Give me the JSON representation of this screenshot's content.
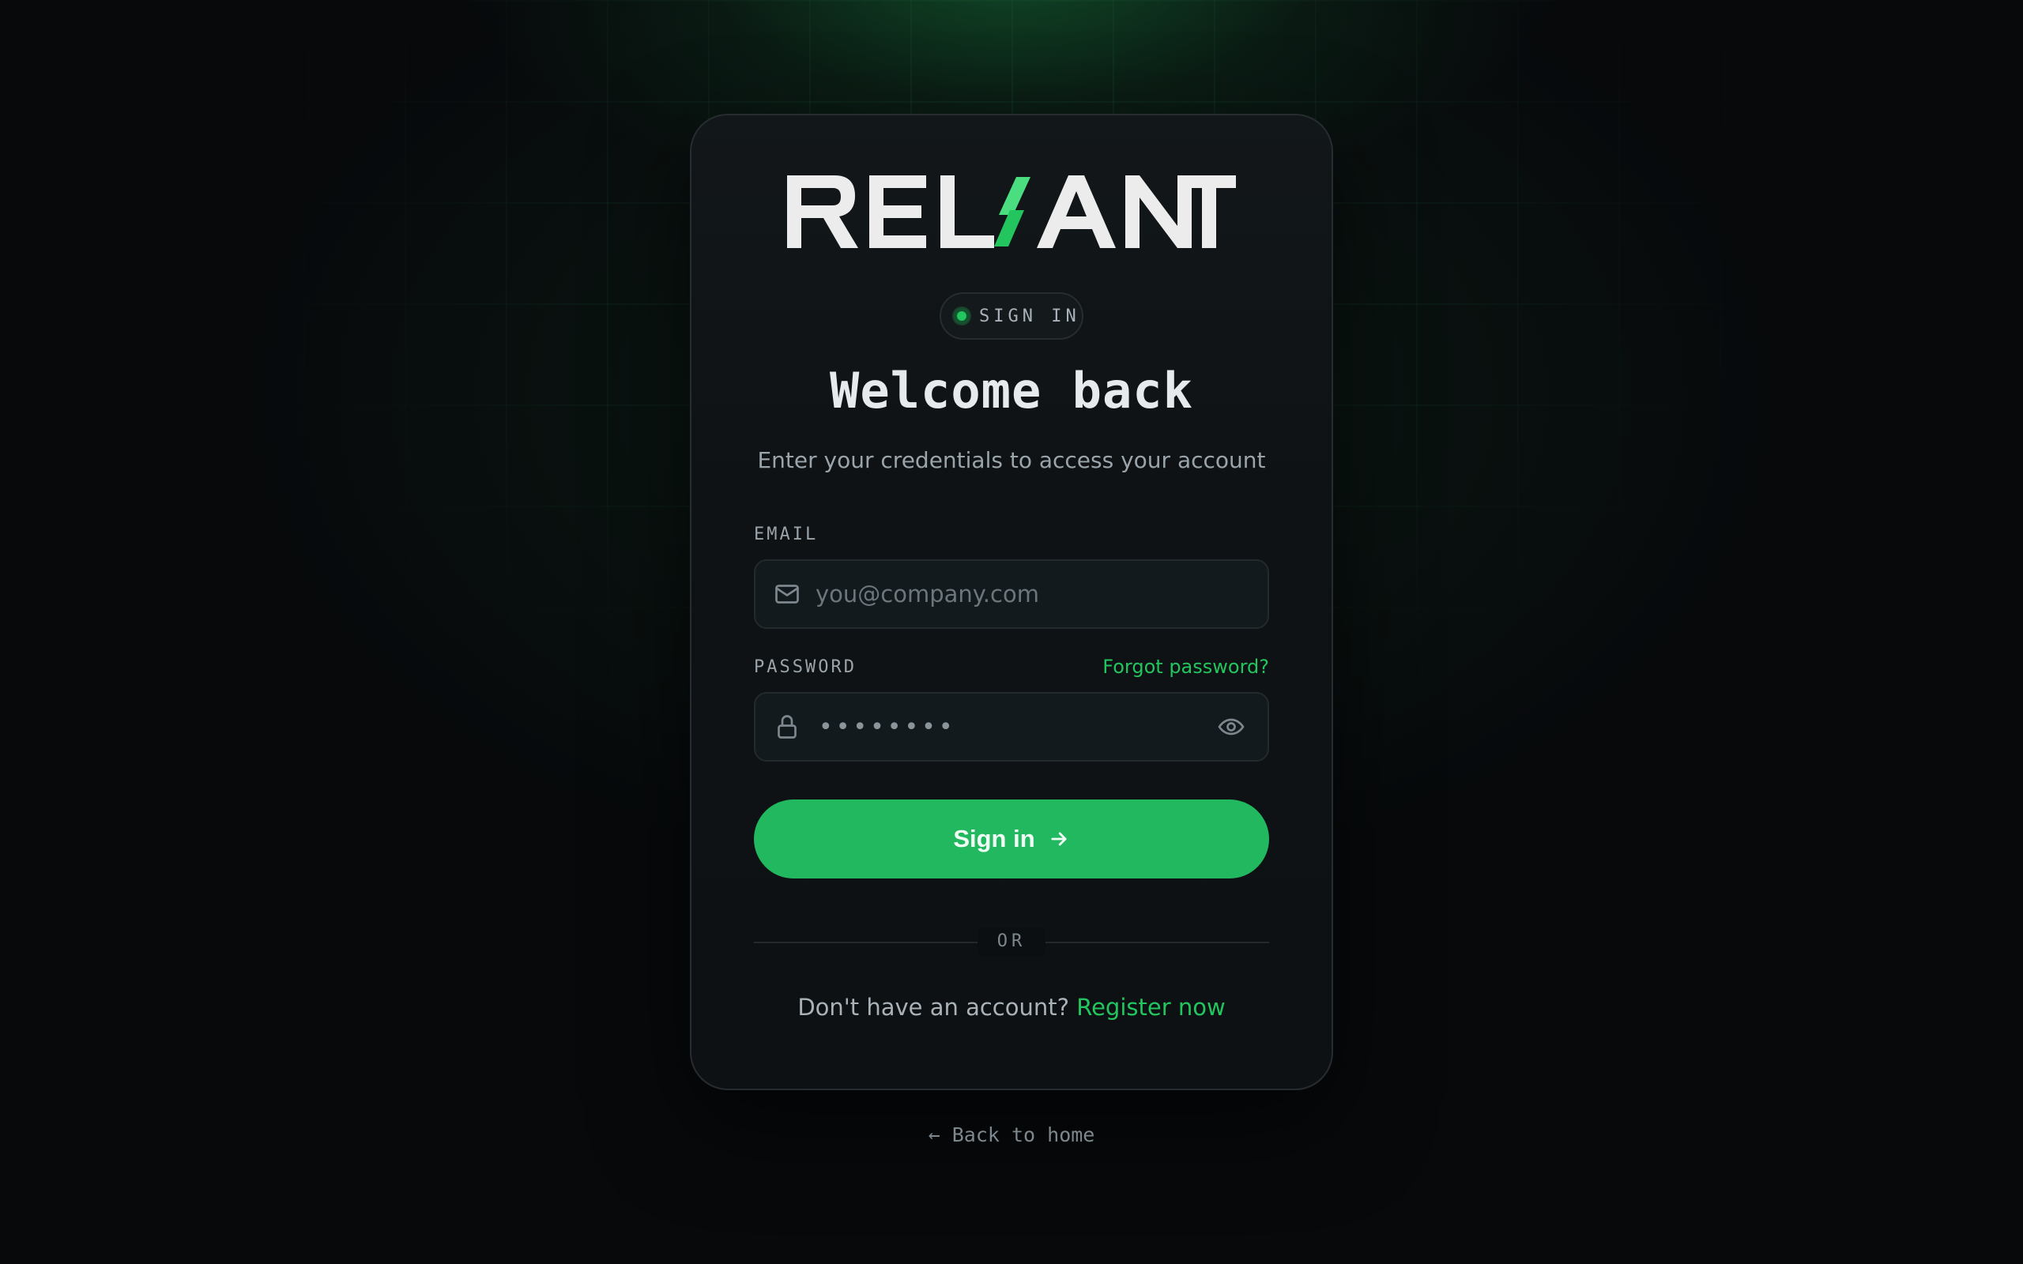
{
  "brand": {
    "name": "RELIANT",
    "accent_color": "#4ade80",
    "primary_color": "#22c55e"
  },
  "badge": {
    "label": "SIGN IN",
    "icon": "status-dot"
  },
  "header": {
    "title": "Welcome back",
    "subtitle": "Enter your credentials to access your account"
  },
  "form": {
    "email": {
      "label": "EMAIL",
      "placeholder": "you@company.com",
      "value": "",
      "icon": "mail-icon"
    },
    "password": {
      "label": "PASSWORD",
      "masked_value": "••••••••",
      "icon": "lock-icon",
      "toggle_icon": "eye-icon",
      "forgot_label": "Forgot password?"
    },
    "submit": {
      "label": "Sign in",
      "icon": "arrow-right-icon"
    }
  },
  "divider": {
    "label": "OR"
  },
  "register": {
    "prompt": "Don't have an account?",
    "link_label": "Register now"
  },
  "footer": {
    "back_label": "← Back to home"
  }
}
